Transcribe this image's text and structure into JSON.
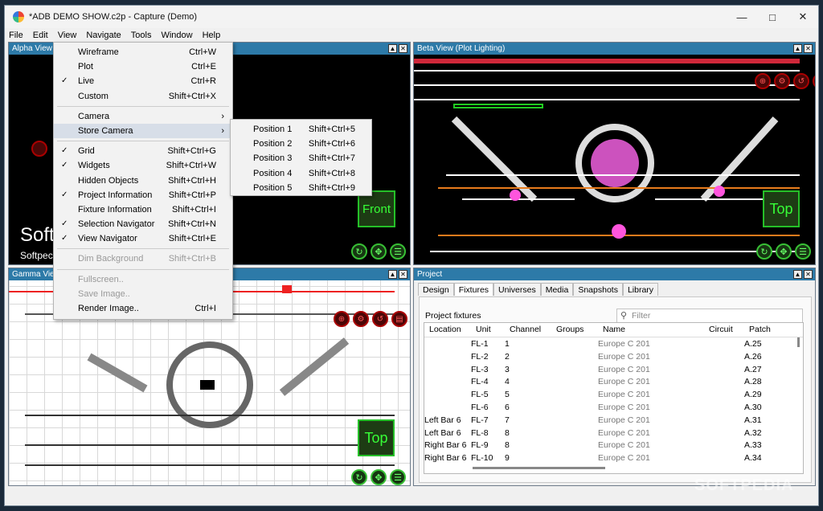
{
  "window": {
    "title": "*ADB DEMO SHOW.c2p - Capture (Demo)"
  },
  "menubar": [
    "File",
    "Edit",
    "View",
    "Navigate",
    "Tools",
    "Window",
    "Help"
  ],
  "panes": {
    "alpha": {
      "title": "Alpha View",
      "label": "Front",
      "watermark": "Soft",
      "watermark2": "Softpec"
    },
    "beta": {
      "title": "Beta View  (Plot Lighting)",
      "label": "Top"
    },
    "gamma": {
      "title": "Gamma View",
      "label": "Top"
    }
  },
  "view_menu": {
    "items": [
      {
        "label": "Wireframe",
        "shortcut": "Ctrl+W",
        "checked": false
      },
      {
        "label": "Plot",
        "shortcut": "Ctrl+E",
        "checked": false
      },
      {
        "label": "Live",
        "shortcut": "Ctrl+R",
        "checked": true
      },
      {
        "label": "Custom",
        "shortcut": "Shift+Ctrl+X",
        "checked": false
      },
      {
        "label": "Camera",
        "shortcut": "",
        "checked": false,
        "submenu": true
      },
      {
        "label": "Store Camera",
        "shortcut": "",
        "checked": false,
        "submenu": true
      },
      {
        "label": "Grid",
        "shortcut": "Shift+Ctrl+G",
        "checked": true
      },
      {
        "label": "Widgets",
        "shortcut": "Shift+Ctrl+W",
        "checked": true
      },
      {
        "label": "Hidden Objects",
        "shortcut": "Shift+Ctrl+H",
        "checked": false
      },
      {
        "label": "Project Information",
        "shortcut": "Shift+Ctrl+P",
        "checked": true
      },
      {
        "label": "Fixture Information",
        "shortcut": "Shift+Ctrl+I",
        "checked": false
      },
      {
        "label": "Selection Navigator",
        "shortcut": "Shift+Ctrl+N",
        "checked": true
      },
      {
        "label": "View Navigator",
        "shortcut": "Shift+Ctrl+E",
        "checked": true
      },
      {
        "label": "Dim Background",
        "shortcut": "Shift+Ctrl+B",
        "checked": false
      },
      {
        "label": "Fullscreen..",
        "shortcut": "",
        "checked": false
      },
      {
        "label": "Save Image..",
        "shortcut": "",
        "checked": false
      },
      {
        "label": "Render Image..",
        "shortcut": "Ctrl+I",
        "checked": false
      }
    ]
  },
  "store_camera_menu": [
    {
      "label": "Position 1",
      "shortcut": "Shift+Ctrl+5"
    },
    {
      "label": "Position 2",
      "shortcut": "Shift+Ctrl+6"
    },
    {
      "label": "Position 3",
      "shortcut": "Shift+Ctrl+7"
    },
    {
      "label": "Position 4",
      "shortcut": "Shift+Ctrl+8"
    },
    {
      "label": "Position 5",
      "shortcut": "Shift+Ctrl+9"
    }
  ],
  "project": {
    "title": "Project",
    "tabs": [
      "Design",
      "Fixtures",
      "Universes",
      "Media",
      "Snapshots",
      "Library"
    ],
    "active_tab": "Fixtures",
    "section_label": "Project fixtures",
    "filter_placeholder": "Filter",
    "columns": [
      "Location",
      "Unit",
      "Channel",
      "Groups",
      "Name",
      "Circuit",
      "Patch"
    ],
    "rows": [
      [
        "",
        "FL-1",
        "1",
        "",
        "Europe C 201",
        "",
        "A.25"
      ],
      [
        "",
        "FL-2",
        "2",
        "",
        "Europe C 201",
        "",
        "A.26"
      ],
      [
        "",
        "FL-3",
        "3",
        "",
        "Europe C 201",
        "",
        "A.27"
      ],
      [
        "",
        "FL-4",
        "4",
        "",
        "Europe C 201",
        "",
        "A.28"
      ],
      [
        "",
        "FL-5",
        "5",
        "",
        "Europe C 201",
        "",
        "A.29"
      ],
      [
        "",
        "FL-6",
        "6",
        "",
        "Europe C 201",
        "",
        "A.30"
      ],
      [
        "Left Bar 6",
        "FL-7",
        "7",
        "",
        "Europe C 201",
        "",
        "A.31"
      ],
      [
        "Left Bar 6",
        "FL-8",
        "8",
        "",
        "Europe C 201",
        "",
        "A.32"
      ],
      [
        "Right Bar 6",
        "FL-9",
        "8",
        "",
        "Europe C 201",
        "",
        "A.33"
      ],
      [
        "Right Bar 6",
        "FL-10",
        "9",
        "",
        "Europe C 201",
        "",
        "A.34"
      ]
    ]
  },
  "watermark": "SOFTPEDIA"
}
